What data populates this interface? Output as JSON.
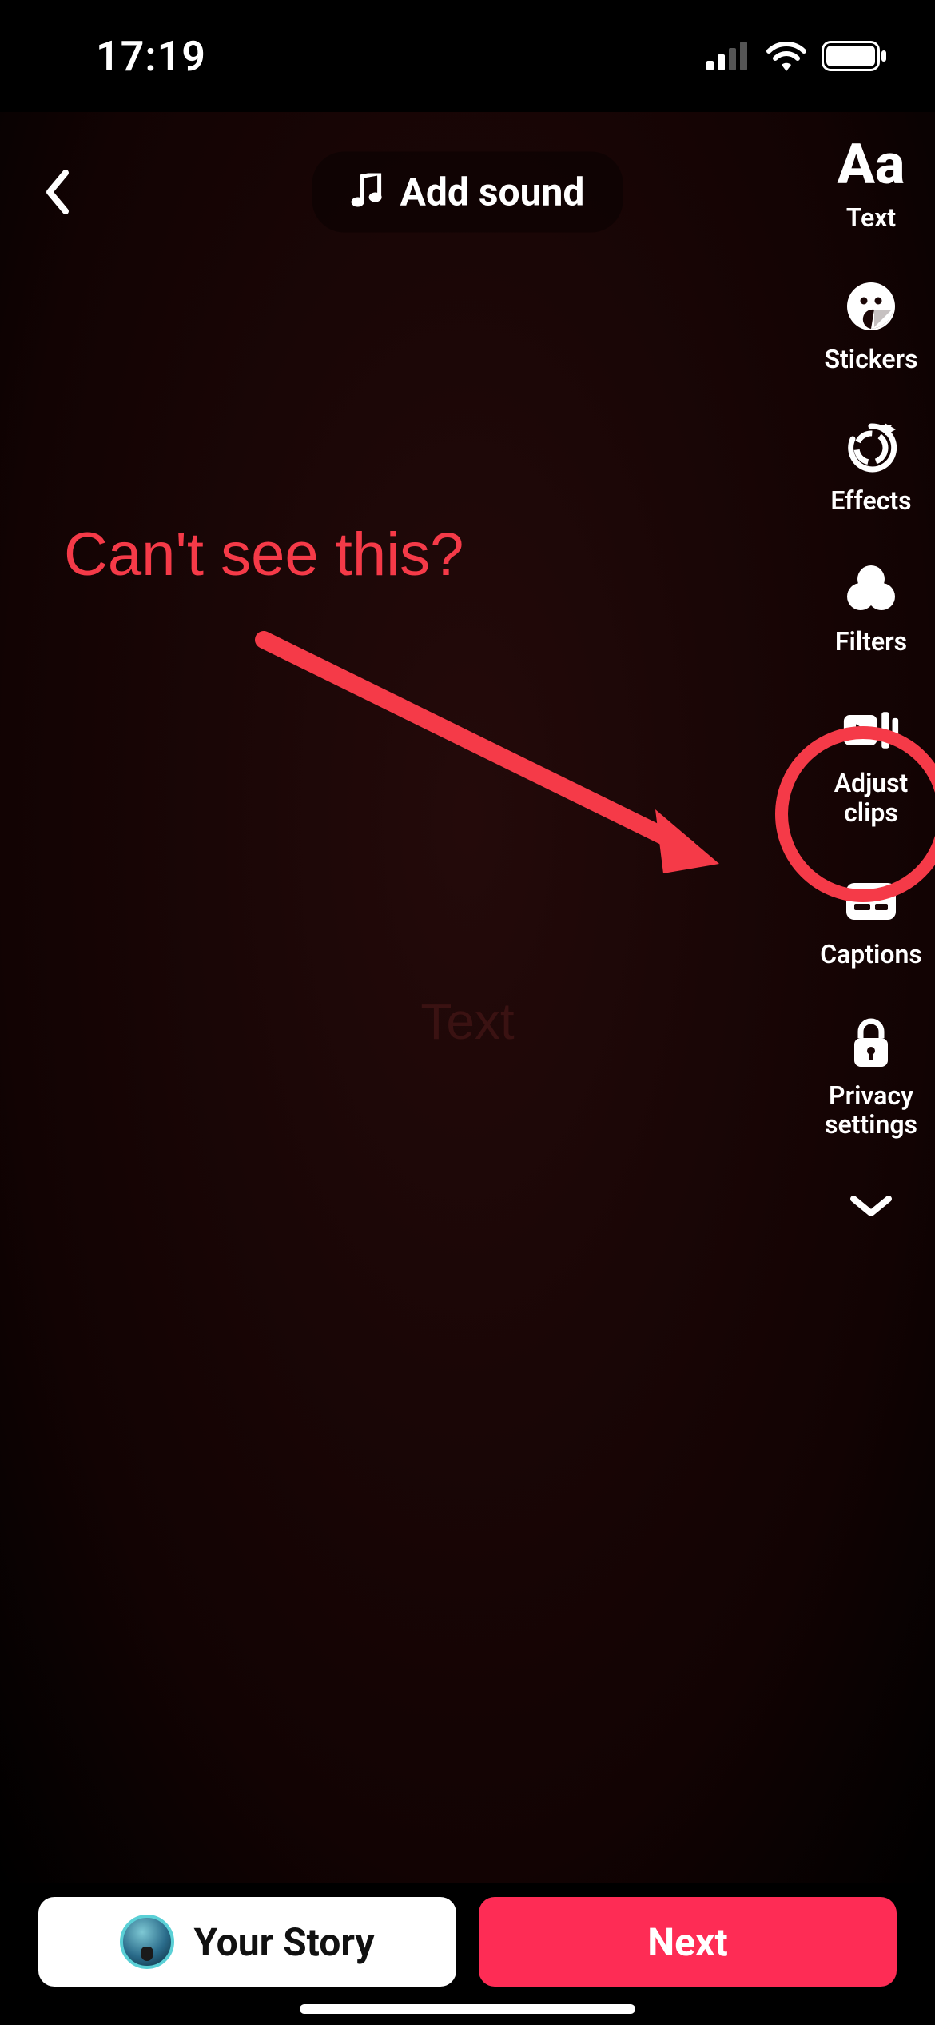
{
  "status": {
    "time": "17:19"
  },
  "topbar": {
    "add_sound_label": "Add sound"
  },
  "tools": {
    "text": "Text",
    "stickers": "Stickers",
    "effects": "Effects",
    "filters": "Filters",
    "adjust_clips": "Adjust clips",
    "captions": "Captions",
    "privacy_settings": "Privacy\nsettings"
  },
  "annotation": {
    "text": "Can't see this?"
  },
  "center_ghost": "Text",
  "bottom": {
    "your_story": "Your Story",
    "next": "Next"
  },
  "colors": {
    "accent": "#fe2c55",
    "annotation": "#f53a48"
  }
}
